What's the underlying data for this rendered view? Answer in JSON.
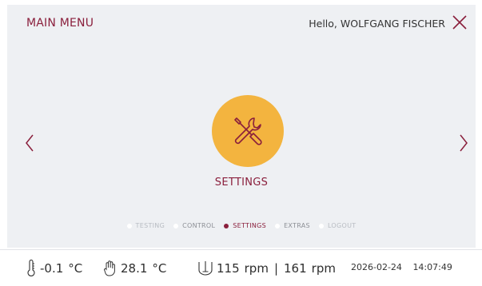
{
  "header": {
    "title": "MAIN MENU",
    "greeting": "Hello, WOLFGANG FISCHER"
  },
  "carousel": {
    "current_label": "SETTINGS",
    "current_icon": "tools-icon",
    "icon_color": "#f3b43f"
  },
  "pager": [
    {
      "label": "TESTING",
      "active": false
    },
    {
      "label": "CONTROL",
      "active": false
    },
    {
      "label": "SETTINGS",
      "active": true
    },
    {
      "label": "EXTRAS",
      "active": false
    },
    {
      "label": "LOGOUT",
      "active": false
    }
  ],
  "status": {
    "temp1_value": "-0.1",
    "temp1_unit": "°C",
    "temp2_value": "28.1",
    "temp2_unit": "°C",
    "rpm1_value": "115",
    "rpm1_unit": "rpm",
    "separator": "|",
    "rpm2_value": "161",
    "rpm2_unit": "rpm",
    "date": "2026-02-24",
    "time": "14:07:49"
  },
  "colors": {
    "accent": "#8a1f3c",
    "panel_bg": "#eef0f3"
  }
}
